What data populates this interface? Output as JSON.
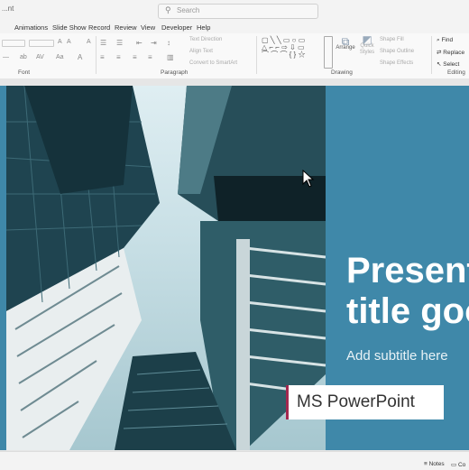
{
  "titlebar": {
    "app_label": "...nt",
    "search_placeholder": "Search"
  },
  "tabs": [
    "Animations",
    "Slide Show",
    "Record",
    "Review",
    "View",
    "Developer",
    "Help"
  ],
  "ribbon": {
    "groups": {
      "font": "Font",
      "paragraph": "Paragraph",
      "drawing": "Drawing",
      "editing": "Editing"
    },
    "paragraph": {
      "text_direction": "Text Direction",
      "align_text": "Align Text",
      "convert_smartart": "Convert to SmartArt"
    },
    "drawing": {
      "arrange": "Arrange",
      "quick_styles": "Quick Styles",
      "shape_fill": "Shape Fill",
      "shape_outline": "Shape Outline",
      "shape_effects": "Shape Effects"
    },
    "editing": {
      "find": "Find",
      "replace": "Replace",
      "select": "Select"
    }
  },
  "slide": {
    "title_line1": "Present",
    "title_line2": "title goo",
    "subtitle": "Add subtitle here",
    "badge": "MS PowerPoint"
  },
  "status": {
    "notes": "Notes",
    "comments": "Co"
  },
  "colors": {
    "slide_bg": "#3f88a9",
    "badge_border": "#a3284f",
    "title": "#ffffff"
  }
}
